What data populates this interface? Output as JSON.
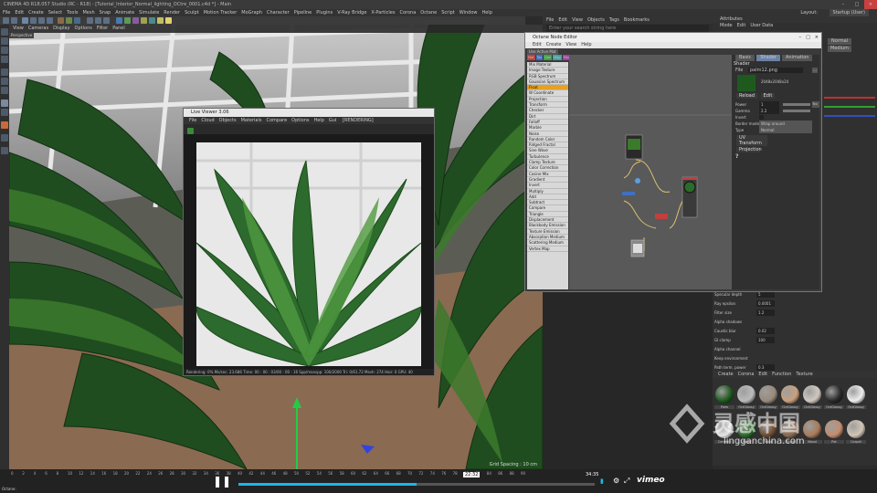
{
  "window": {
    "title": "CINEMA 4D R18.057 Studio (RC - R18) - [Tutorial_Interior_Normal_lighting_OCtre_0001.c4d *] - Main",
    "layout_label": "Layout:",
    "layout_value": "Startup (User)"
  },
  "menubar": [
    "File",
    "Edit",
    "Create",
    "Select",
    "Tools",
    "Mesh",
    "Snap",
    "Animate",
    "Simulate",
    "Render",
    "Sculpt",
    "Motion Tracker",
    "MoGraph",
    "Character",
    "Pipeline",
    "Plugins",
    "V-Ray Bridge",
    "X-Particles",
    "Corona",
    "Octane",
    "Script",
    "Window",
    "Help"
  ],
  "viewport": {
    "menu": [
      "View",
      "Cameras",
      "Display",
      "Options",
      "Filter",
      "Panel"
    ],
    "perspective_label": "Perspective",
    "grid_status": "Grid Spacing : 10 cm"
  },
  "live_viewer": {
    "title": "Live Viewer 3.06",
    "menu": [
      "File",
      "Cloud",
      "Objects",
      "Materials",
      "Compare",
      "Options",
      "Help",
      "Gui"
    ],
    "rendering_label": "[RENDERING]",
    "status": "Rendering: 0%   Ms/sec: 23.686   Time: 00 : 00 : 03/00 : 00 : 16   Spp/maxspp: 100/2000   Tri: 0/61.72   Mesh: 274   Hair: 0   GPU: 40"
  },
  "node_editor": {
    "title": "Octane Node Editor",
    "menu": [
      "Edit",
      "Create",
      "View",
      "Help"
    ],
    "filter_label": "Use Active Mat",
    "tabs": [
      "Mat",
      "Tex",
      "Gen",
      "Map",
      "Med",
      "Oth",
      "Proj",
      "Emi",
      "Cwn"
    ],
    "node_list": [
      "Mix Material",
      "Image Texture",
      "RGB Spectrum",
      "Gaussian Spectrum",
      "Float",
      "W Coordinate",
      "Projection",
      "Transform",
      "Checker",
      "Dirt",
      "Falloff",
      "Marble",
      "Noise",
      "Random Color",
      "Ridged Fractal",
      "Sine Wave",
      "Turbulence",
      "Clamp Texture",
      "Color Correction",
      "Cosine Mix",
      "Gradient",
      "Invert",
      "Multiply",
      "Add",
      "Subtract",
      "Compare",
      "Triangle",
      "Displacement",
      "Blackbody Emission",
      "Texture Emission",
      "Absorption Medium",
      "Scattering Medium",
      "Vertex Map"
    ],
    "attr_tabs": [
      "Basic",
      "Shader",
      "Animation"
    ],
    "attr_header": "Shader",
    "attr_file_label": "File",
    "attr_file_value": "palm12.png",
    "attr_size": "2048x2048x24",
    "attr_reload": "Reload",
    "attr_edit": "Edit",
    "attr_fields": [
      {
        "label": "Power",
        "value": "1"
      },
      {
        "label": "Gamma",
        "value": "2.2"
      },
      {
        "label": "Invert",
        "value": ""
      },
      {
        "label": "Border mode",
        "value": "Wrap around"
      },
      {
        "label": "Type",
        "value": "Normal"
      }
    ],
    "attr_buttons": [
      "UV Transform",
      "Projection"
    ],
    "question": "?"
  },
  "object_manager": {
    "menu": [
      "File",
      "Edit",
      "View",
      "Objects",
      "Tags",
      "Bookmarks"
    ],
    "search_placeholder": "Enter your search string here",
    "rows": [
      "Palm_Plane",
      "Plane"
    ]
  },
  "attributes": {
    "title": "Attributes",
    "menu": [
      "Mode",
      "Edit",
      "User Data"
    ],
    "normal_label": "Normal",
    "medium_label": "Medium",
    "params": [
      {
        "label": "Specular depth",
        "value": "5"
      },
      {
        "label": "Ray epsilon",
        "value": "0.0001"
      },
      {
        "label": "Filter size",
        "value": "1.2"
      },
      {
        "label": "Alpha shadows",
        "value": ""
      },
      {
        "label": "Caustic blur",
        "value": "0.02"
      },
      {
        "label": "GI clamp",
        "value": "100"
      },
      {
        "label": "Alpha channel",
        "value": ""
      },
      {
        "label": "Keep environment",
        "value": ""
      },
      {
        "label": "Path term. power",
        "value": "0.3"
      }
    ]
  },
  "material_manager": {
    "menu": [
      "Create",
      "Corona",
      "Edit",
      "Function",
      "Texture"
    ],
    "materials": [
      {
        "name": "Palm",
        "color": "#1e5a1e"
      },
      {
        "name": "OctGlossy",
        "color": "#bbbbbb"
      },
      {
        "name": "OctGlossy",
        "color": "#9a8a7a"
      },
      {
        "name": "OctGlossy",
        "color": "#c9a07c"
      },
      {
        "name": "OctGlossy",
        "color": "#d0c8bf"
      },
      {
        "name": "OctGlossy",
        "color": "#2a2a2a"
      },
      {
        "name": "OctGlossy",
        "color": "#eeeeee"
      },
      {
        "name": "Ceramic",
        "color": "#e6e6e6"
      },
      {
        "name": "Palm",
        "color": "#2b6b2b"
      },
      {
        "name": "Trunk",
        "color": "#6a4a30"
      },
      {
        "name": "Trunk",
        "color": "#8a6a50"
      },
      {
        "name": "Wood",
        "color": "#a87a5a"
      },
      {
        "name": "Pot",
        "color": "#c48c6e"
      },
      {
        "name": "Carpet",
        "color": "#d2c5b5"
      }
    ]
  },
  "timeline": {
    "frames": [
      "0",
      "2",
      "4",
      "6",
      "8",
      "10",
      "12",
      "14",
      "16",
      "18",
      "20",
      "22",
      "24",
      "26",
      "28",
      "30",
      "32",
      "34",
      "36",
      "38",
      "40",
      "42",
      "44",
      "46",
      "48",
      "50",
      "52",
      "54",
      "56",
      "58",
      "60",
      "62",
      "64",
      "66",
      "68",
      "70",
      "72",
      "74",
      "76",
      "78",
      "80",
      "82",
      "84",
      "86",
      "88",
      "90"
    ],
    "player_time_current": "22:32",
    "player_time_total": "34:35",
    "vimeo_label": "vimeo",
    "status_left": "Octane:",
    "progress": 0.5
  },
  "watermark": {
    "brand": "灵感中国",
    "url": "lingganchina.com"
  }
}
